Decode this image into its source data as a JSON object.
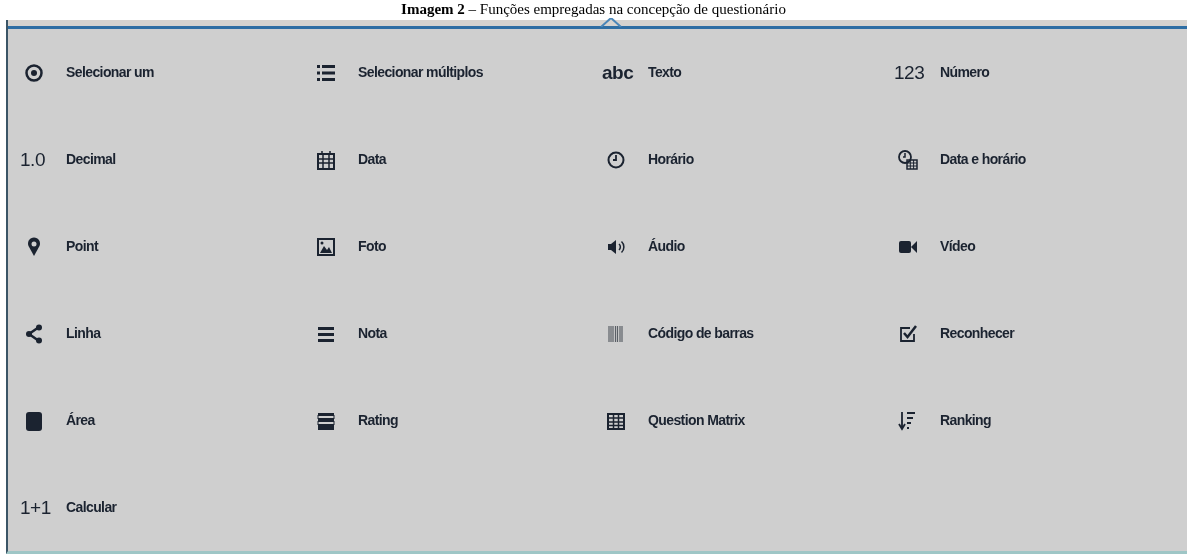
{
  "caption": "**Imagem 2** – Funções empregadas na concepção de questionário",
  "question_types": [
    {
      "label": "Selecionar um"
    },
    {
      "label": "Selecionar múltiplos"
    },
    {
      "label": "Texto",
      "glyph": "abc"
    },
    {
      "label": "Número",
      "glyph": "123"
    },
    {
      "label": "Decimal",
      "glyph": "1.0"
    },
    {
      "label": "Data"
    },
    {
      "label": "Horário"
    },
    {
      "label": "Data e horário"
    },
    {
      "label": "Point"
    },
    {
      "label": "Foto"
    },
    {
      "label": "Áudio"
    },
    {
      "label": "Vídeo"
    },
    {
      "label": "Linha"
    },
    {
      "label": "Nota"
    },
    {
      "label": "Código de barras"
    },
    {
      "label": "Reconhecer"
    },
    {
      "label": "Área"
    },
    {
      "label": "Rating"
    },
    {
      "label": "Question Matrix"
    },
    {
      "label": "Ranking"
    },
    {
      "label": "Calcular",
      "glyph": "1+1"
    }
  ]
}
